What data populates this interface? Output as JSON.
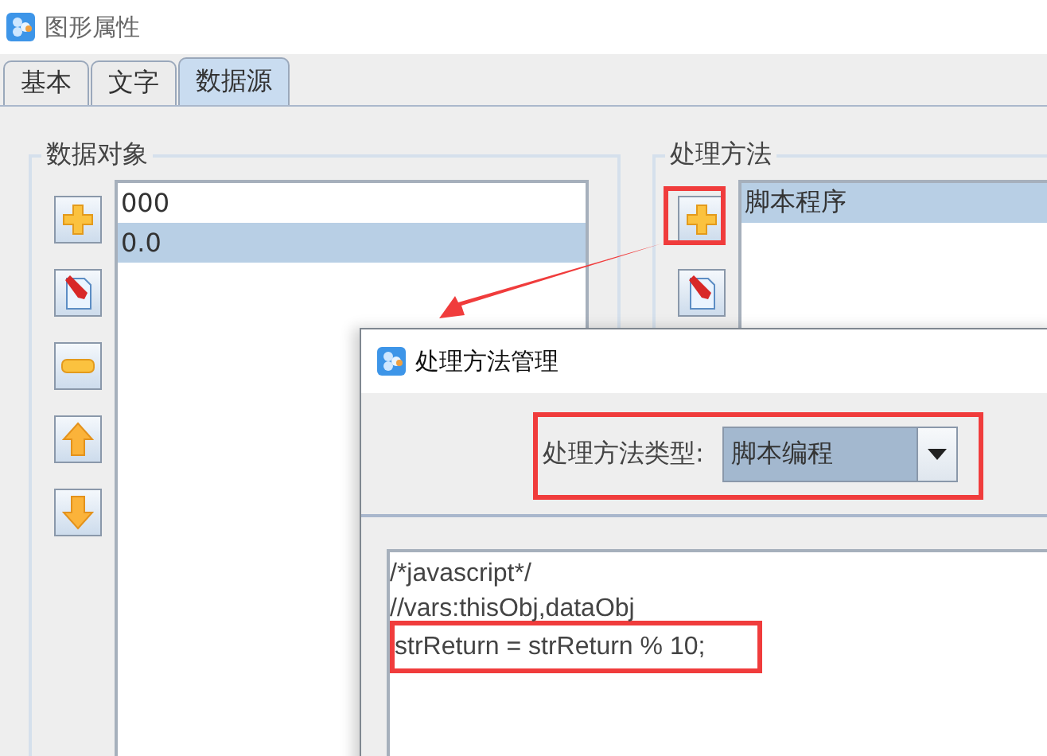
{
  "window": {
    "title": "图形属性"
  },
  "tabs": [
    {
      "label": "基本",
      "selected": false
    },
    {
      "label": "文字",
      "selected": false
    },
    {
      "label": "数据源",
      "selected": true
    }
  ],
  "data_objects": {
    "title": "数据对象",
    "buttons": [
      {
        "kind": "add"
      },
      {
        "kind": "edit"
      },
      {
        "kind": "remove"
      },
      {
        "kind": "up"
      },
      {
        "kind": "down"
      }
    ],
    "items": [
      {
        "label": "000",
        "selected": false
      },
      {
        "label": "0.0",
        "selected": true
      }
    ]
  },
  "processing_methods": {
    "title": "处理方法",
    "buttons": [
      {
        "kind": "add"
      },
      {
        "kind": "edit"
      }
    ],
    "items": [
      {
        "label": "脚本程序",
        "selected": true
      }
    ]
  },
  "dialog": {
    "title": "处理方法管理",
    "type_label": "处理方法类型:",
    "type_value": "脚本编程",
    "code": [
      "/*javascript*/",
      "//vars:thisObj,dataObj",
      "strReturn = strReturn % 10;"
    ]
  }
}
